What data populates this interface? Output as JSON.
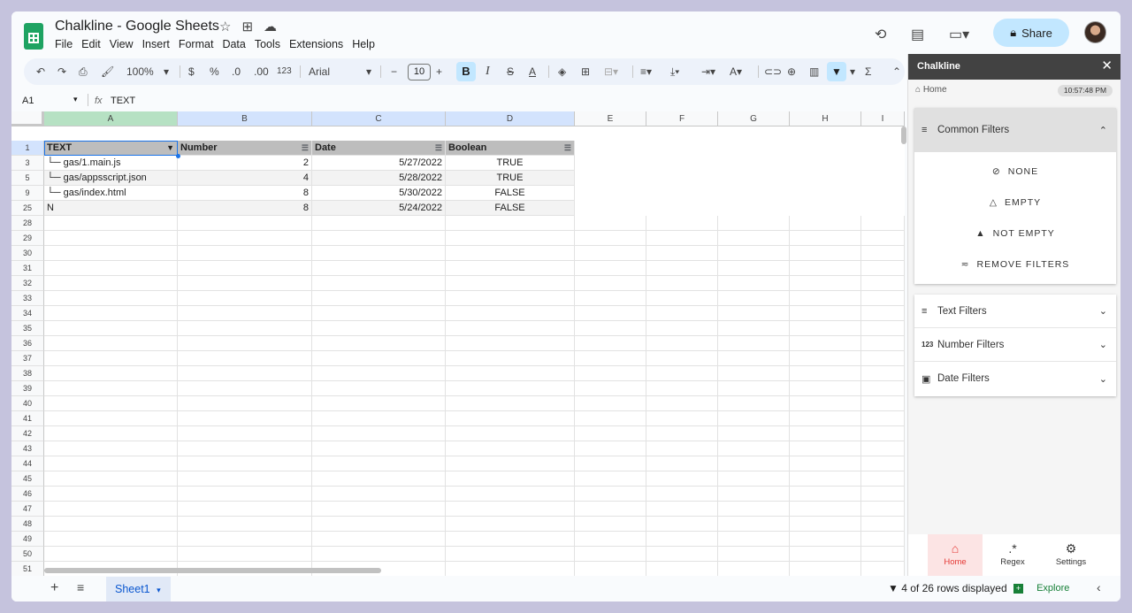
{
  "app": {
    "title": "Chalkline - Google Sheets",
    "menu": [
      "File",
      "Edit",
      "View",
      "Insert",
      "Format",
      "Data",
      "Tools",
      "Extensions",
      "Help"
    ],
    "share_label": "Share"
  },
  "toolbar": {
    "zoom": "100%",
    "currency": "$",
    "percent": "%",
    "dec_less": ".0",
    "dec_more": ".00",
    "format_123": "123",
    "font": "Arial",
    "font_size": "10"
  },
  "formula": {
    "cell_ref": "A1",
    "fx": "fx",
    "value": "TEXT"
  },
  "columns": [
    "A",
    "B",
    "C",
    "D",
    "E",
    "F",
    "G",
    "H",
    "I"
  ],
  "header_row": {
    "num": "1",
    "cells": [
      "TEXT",
      "Number",
      "Date",
      "Boolean"
    ]
  },
  "rows": [
    {
      "num": "3",
      "cells": [
        "└─ gas/1.main.js",
        "2",
        "5/27/2022",
        "TRUE"
      ]
    },
    {
      "num": "5",
      "cells": [
        "└─ gas/appsscript.json",
        "4",
        "5/28/2022",
        "TRUE"
      ]
    },
    {
      "num": "9",
      "cells": [
        "└─ gas/index.html",
        "8",
        "5/30/2022",
        "FALSE"
      ]
    },
    {
      "num": "25",
      "cells": [
        "N",
        "8",
        "5/24/2022",
        "FALSE"
      ]
    }
  ],
  "empty_rows": [
    "28",
    "29",
    "30",
    "31",
    "32",
    "33",
    "34",
    "35",
    "36",
    "37",
    "38",
    "39",
    "40",
    "41",
    "42",
    "43",
    "44",
    "45",
    "46",
    "47",
    "48",
    "49",
    "50",
    "51"
  ],
  "bottom": {
    "sheet_tab": "Sheet1",
    "rows_displayed": "4 of 26 rows displayed",
    "explore": "Explore"
  },
  "sidebar": {
    "title": "Chalkline",
    "crumb": "Home",
    "time": "10:57:48 PM",
    "common_filters": {
      "label": "Common Filters",
      "options": [
        "NONE",
        "EMPTY",
        "NOT EMPTY",
        "REMOVE FILTERS"
      ]
    },
    "sections": [
      {
        "label": "Text Filters",
        "icon": "≡"
      },
      {
        "label": "Number Filters",
        "icon": "123"
      },
      {
        "label": "Date Filters",
        "icon": "▣"
      }
    ],
    "nav": [
      "Home",
      "Regex",
      "Settings"
    ]
  },
  "colors": {
    "share_bg": "#c2e7ff",
    "header_bg": "#bdbdbd",
    "accent_home": "#e53935",
    "sheets_green": "#1ea362"
  }
}
